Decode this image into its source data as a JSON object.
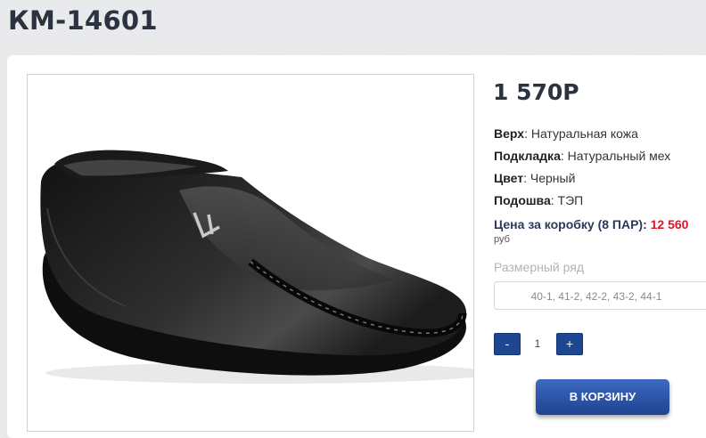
{
  "page": {
    "title": "КМ-14601"
  },
  "product": {
    "price": "1 570Р",
    "specs": [
      {
        "key": "Верх",
        "value": "Натуральная кожа"
      },
      {
        "key": "Подкладка",
        "value": "Натуральный мех"
      },
      {
        "key": "Цвет",
        "value": "Черный"
      },
      {
        "key": "Подошва",
        "value": "ТЭП"
      }
    ],
    "box_price": {
      "label": "Цена за коробку (8 ПАР):",
      "value": "12 560",
      "unit": "руб"
    },
    "sizes": {
      "label": "Размерный ряд",
      "value": "40-1, 41-2, 42-2, 43-2, 44-1"
    },
    "quantity": {
      "minus": "-",
      "value": "1",
      "plus": "+"
    },
    "cart_button": "В КОРЗИНУ",
    "image_icon": "black-leather-loafer-photo"
  },
  "colors": {
    "accent": "#1f4690",
    "price_red": "#d9142b",
    "title": "#2b3340"
  }
}
